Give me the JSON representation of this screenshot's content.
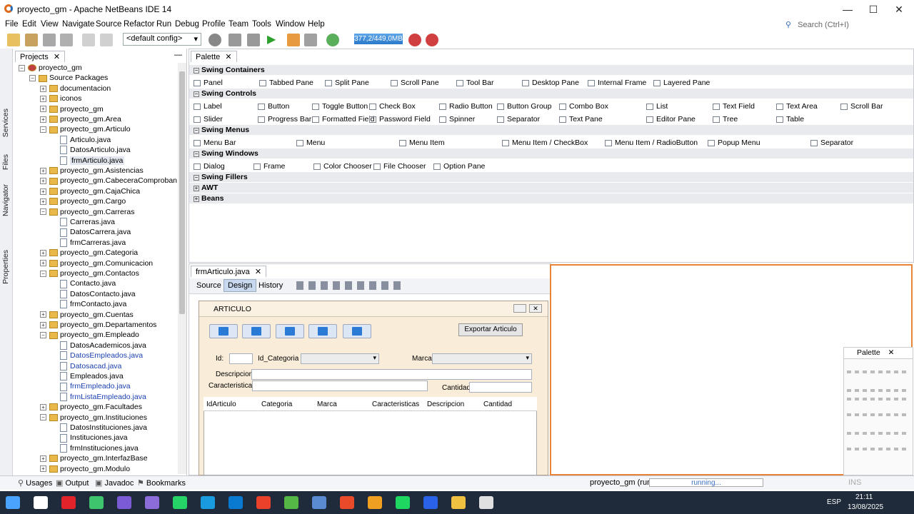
{
  "window": {
    "title": "proyecto_gm - Apache NetBeans IDE 14",
    "minimize": "—",
    "maximize": "☐",
    "close": "✕"
  },
  "menubar": {
    "items": [
      "File",
      "Edit",
      "View",
      "Navigate",
      "Source",
      "Refactor",
      "Run",
      "Debug",
      "Profile",
      "Team",
      "Tools",
      "Window",
      "Help"
    ]
  },
  "search": {
    "placeholder": "Search (Ctrl+I)"
  },
  "toolbar": {
    "config": "<default config>",
    "memory": "377,2/449,0MB"
  },
  "side_tabs": [
    "Services",
    "Files",
    "Projects",
    "Navigator",
    "Properties"
  ],
  "projects_panel": {
    "tab": "Projects"
  },
  "tree": [
    {
      "label": "proyecto_gm",
      "level": 0,
      "kind": "project",
      "expander": "−"
    },
    {
      "label": "Source Packages",
      "level": 1,
      "kind": "pkg",
      "expander": "−"
    },
    {
      "label": "documentacion",
      "level": 2,
      "kind": "pkg",
      "expander": "+"
    },
    {
      "label": "iconos",
      "level": 2,
      "kind": "pkg",
      "expander": "+"
    },
    {
      "label": "proyecto_gm",
      "level": 2,
      "kind": "pkg",
      "expander": "+"
    },
    {
      "label": "proyecto_gm.Area",
      "level": 2,
      "kind": "pkg",
      "expander": "+"
    },
    {
      "label": "proyecto_gm.Articulo",
      "level": 2,
      "kind": "pkg",
      "expander": "−"
    },
    {
      "label": "Articulo.java",
      "level": 3,
      "kind": "file"
    },
    {
      "label": "DatosArticulo.java",
      "level": 3,
      "kind": "file"
    },
    {
      "label": "frmArticulo.java",
      "level": 3,
      "kind": "file",
      "selected": true
    },
    {
      "label": "proyecto_gm.Asistencias",
      "level": 2,
      "kind": "pkg",
      "expander": "+"
    },
    {
      "label": "proyecto_gm.CabeceraComprobante",
      "level": 2,
      "kind": "pkg",
      "expander": "+"
    },
    {
      "label": "proyecto_gm.CajaChica",
      "level": 2,
      "kind": "pkg",
      "expander": "+"
    },
    {
      "label": "proyecto_gm.Cargo",
      "level": 2,
      "kind": "pkg",
      "expander": "+"
    },
    {
      "label": "proyecto_gm.Carreras",
      "level": 2,
      "kind": "pkg",
      "expander": "−"
    },
    {
      "label": "Carreras.java",
      "level": 3,
      "kind": "file"
    },
    {
      "label": "DatosCarrera.java",
      "level": 3,
      "kind": "file"
    },
    {
      "label": "frmCarreras.java",
      "level": 3,
      "kind": "file"
    },
    {
      "label": "proyecto_gm.Categoria",
      "level": 2,
      "kind": "pkg",
      "expander": "+"
    },
    {
      "label": "proyecto_gm.Comunicacion",
      "level": 2,
      "kind": "pkg",
      "expander": "+"
    },
    {
      "label": "proyecto_gm.Contactos",
      "level": 2,
      "kind": "pkg",
      "expander": "−"
    },
    {
      "label": "Contacto.java",
      "level": 3,
      "kind": "file"
    },
    {
      "label": "DatosContacto.java",
      "level": 3,
      "kind": "file"
    },
    {
      "label": "frmContacto.java",
      "level": 3,
      "kind": "file"
    },
    {
      "label": "proyecto_gm.Cuentas",
      "level": 2,
      "kind": "pkg",
      "expander": "+"
    },
    {
      "label": "proyecto_gm.Departamentos",
      "level": 2,
      "kind": "pkg",
      "expander": "+"
    },
    {
      "label": "proyecto_gm.Empleado",
      "level": 2,
      "kind": "pkg",
      "expander": "−"
    },
    {
      "label": "DatosAcademicos.java",
      "level": 3,
      "kind": "file"
    },
    {
      "label": "DatosEmpleados.java",
      "level": 3,
      "kind": "file",
      "modified": true
    },
    {
      "label": "Datosacad.java",
      "level": 3,
      "kind": "file",
      "modified": true
    },
    {
      "label": "Empleados.java",
      "level": 3,
      "kind": "file"
    },
    {
      "label": "frmEmpleado.java",
      "level": 3,
      "kind": "file",
      "modified": true
    },
    {
      "label": "frmListaEmpleado.java",
      "level": 3,
      "kind": "file",
      "modified": true
    },
    {
      "label": "proyecto_gm.Facultades",
      "level": 2,
      "kind": "pkg",
      "expander": "+"
    },
    {
      "label": "proyecto_gm.Instituciones",
      "level": 2,
      "kind": "pkg",
      "expander": "−"
    },
    {
      "label": "DatosInstituciones.java",
      "level": 3,
      "kind": "file"
    },
    {
      "label": "Instituciones.java",
      "level": 3,
      "kind": "file"
    },
    {
      "label": "frmInstituciones.java",
      "level": 3,
      "kind": "file"
    },
    {
      "label": "proyecto_gm.InterfazBase",
      "level": 2,
      "kind": "pkg",
      "expander": "+"
    },
    {
      "label": "proyecto_gm.Modulo",
      "level": 2,
      "kind": "pkg",
      "expander": "+"
    }
  ],
  "palette": {
    "tab": "Palette",
    "categories": [
      {
        "name": "Swing Containers",
        "expander": "−",
        "items": [
          "Panel",
          "Tabbed Pane",
          "Split Pane",
          "Scroll Pane",
          "Tool Bar",
          "Desktop Pane",
          "Internal Frame",
          "Layered Pane"
        ]
      },
      {
        "name": "Swing Controls",
        "expander": "−",
        "items": [
          "Label",
          "Button",
          "Toggle Button",
          "Check Box",
          "Radio Button",
          "Button Group",
          "Combo Box",
          "List",
          "Text Field",
          "Text Area",
          "Scroll Bar",
          "Slider",
          "Progress Bar",
          "Formatted Field",
          "Password Field",
          "Spinner",
          "Separator",
          "Text Pane",
          "Editor Pane",
          "Tree",
          "Table"
        ]
      },
      {
        "name": "Swing Menus",
        "expander": "−",
        "items": [
          "Menu Bar",
          "Menu",
          "Menu Item",
          "Menu Item / CheckBox",
          "Menu Item / RadioButton",
          "Popup Menu",
          "Separator"
        ]
      },
      {
        "name": "Swing Windows",
        "expander": "−",
        "items": [
          "Dialog",
          "Frame",
          "Color Chooser",
          "File Chooser",
          "Option Pane"
        ]
      },
      {
        "name": "Swing Fillers",
        "expander": "−",
        "items": []
      },
      {
        "name": "AWT",
        "expander": "+",
        "items": []
      },
      {
        "name": "Beans",
        "expander": "+",
        "items": []
      }
    ]
  },
  "editor": {
    "tab": "frmArticulo.java",
    "views": [
      "Source",
      "Design",
      "History"
    ],
    "active_view": "Design"
  },
  "form": {
    "title": "ARTICULO",
    "export_button": "Exportar Articulo",
    "labels": {
      "id": "Id:",
      "categoria": "Id_Categoria",
      "marca": "Marca",
      "descripcion": "Descripcion:",
      "caracteristicas": "Caracteristicas",
      "cantidad": "Cantidad"
    },
    "table_columns": [
      "IdArticulo",
      "Categoria",
      "Marca",
      "Caracteristicas",
      "Descripcion",
      "Cantidad"
    ]
  },
  "floating_palette": {
    "title": "Palette"
  },
  "statusbar": {
    "tabs": [
      "Usages",
      "Output",
      "Javadoc",
      "Bookmarks"
    ],
    "run_label": "proyecto_gm (run)",
    "progress": "running...",
    "mode": "INS"
  },
  "taskbar": {
    "lang": "ESP",
    "time": "21:11",
    "date": "13/08/2025",
    "app_colors": [
      "#4aa3ff",
      "#ffffff",
      "#e0242a",
      "#3ec46d",
      "#7b5cd6",
      "#8c6cd8",
      "#25d366",
      "#1a9be0",
      "#0a7ad0",
      "#e8432a",
      "#55b844",
      "#5a8ad0",
      "#e84a2a",
      "#f0a020",
      "#1ed760",
      "#2a62e8",
      "#f0c040",
      "#e0e0e0"
    ]
  }
}
